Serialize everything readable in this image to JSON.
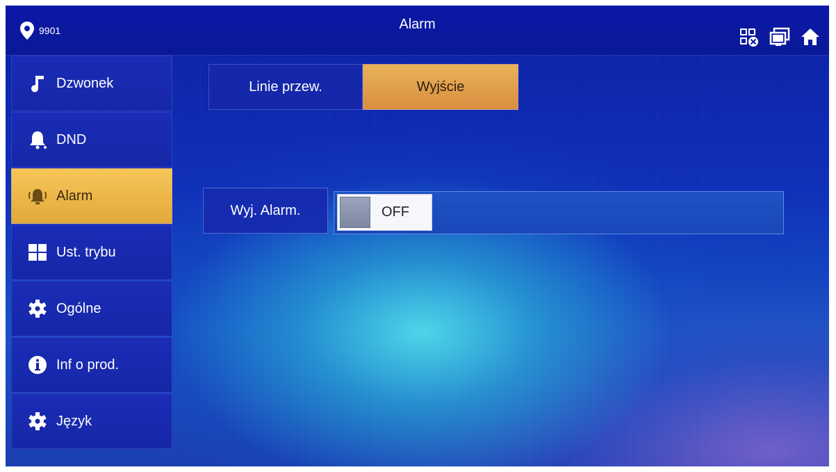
{
  "header": {
    "device_number": "9901",
    "title": "Alarm"
  },
  "sidebar": {
    "items": [
      {
        "label": "Dzwonek",
        "icon": "music-note-icon",
        "active": false
      },
      {
        "label": "DND",
        "icon": "bell-mute-icon",
        "active": false
      },
      {
        "label": "Alarm",
        "icon": "alarm-bell-icon",
        "active": true
      },
      {
        "label": "Ust. trybu",
        "icon": "grid-mode-icon",
        "active": false
      },
      {
        "label": "Ogólne",
        "icon": "gear-icon",
        "active": false
      },
      {
        "label": "Inf o prod.",
        "icon": "info-icon",
        "active": false
      },
      {
        "label": "Język",
        "icon": "gear-icon",
        "active": false
      }
    ]
  },
  "tabs": [
    {
      "label": "Linie przew.",
      "active": false
    },
    {
      "label": "Wyjście",
      "active": true
    }
  ],
  "setting": {
    "label": "Wyj. Alarm.",
    "toggle_state": "OFF"
  },
  "colors": {
    "background": "#0a1f9e",
    "active_item": "#f0b64b",
    "active_tab": "#e3a04c"
  }
}
